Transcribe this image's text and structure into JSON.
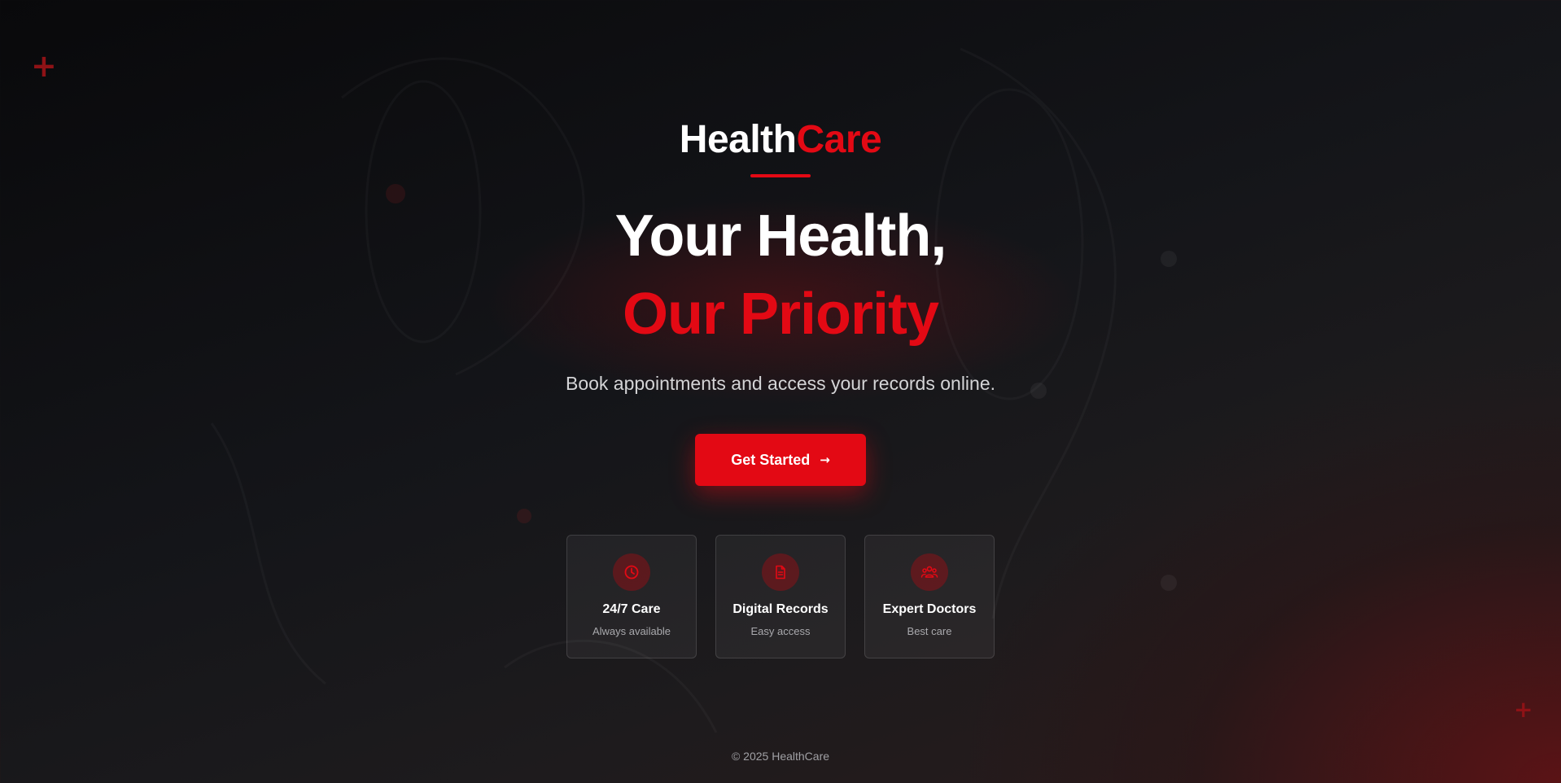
{
  "brand": {
    "part1": "Health",
    "part2": "Care"
  },
  "hero": {
    "headline_line1": "Your Health,",
    "headline_line2": "Our Priority",
    "subtitle": "Book appointments and access your records online."
  },
  "cta": {
    "label": "Get Started",
    "icon": "arrow-right-icon",
    "arrow": "→"
  },
  "features": [
    {
      "icon": "clock-icon",
      "title": "24/7 Care",
      "description": "Always available"
    },
    {
      "icon": "document-icon",
      "title": "Digital Records",
      "description": "Easy access"
    },
    {
      "icon": "users-icon",
      "title": "Expert Doctors",
      "description": "Best care"
    }
  ],
  "decorations": {
    "cross_glyph": "+"
  },
  "footer": {
    "copyright": "© 2025 HealthCare"
  },
  "colors": {
    "accent": "#e30914",
    "background": "#0e0f12",
    "text_primary": "#ffffff",
    "text_secondary": "#d4d4d6",
    "text_muted": "#a9a9ad"
  }
}
